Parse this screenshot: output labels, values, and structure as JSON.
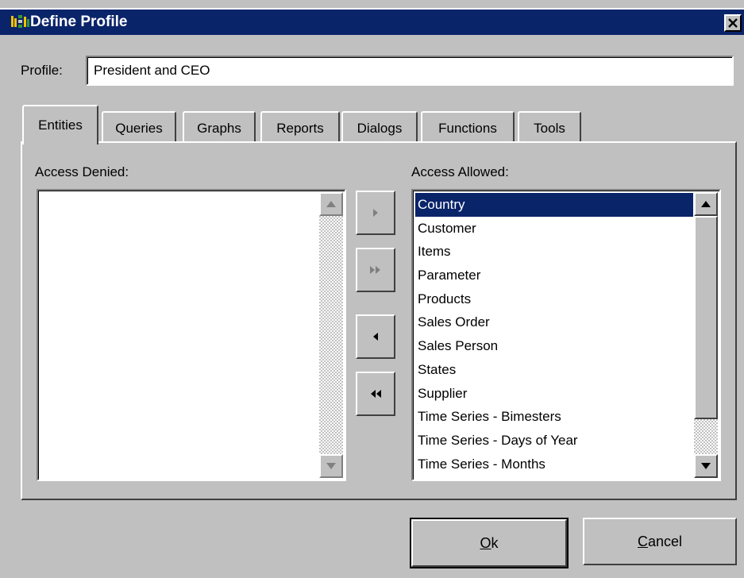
{
  "window": {
    "title": "Define Profile",
    "icon": "app-icon",
    "close_icon": "close-icon"
  },
  "profile": {
    "label": "Profile:",
    "value": "President and CEO"
  },
  "tabs": [
    {
      "label": "Entities",
      "active": true
    },
    {
      "label": "Queries"
    },
    {
      "label": "Graphs"
    },
    {
      "label": "Reports"
    },
    {
      "label": "Dialogs"
    },
    {
      "label": "Functions"
    },
    {
      "label": "Tools"
    }
  ],
  "denied": {
    "caption": "Access Denied:",
    "items": []
  },
  "allowed": {
    "caption": "Access Allowed:",
    "selected": "Country",
    "items": [
      "Country",
      "Customer",
      "Items",
      "Parameter",
      "Products",
      "Sales Order",
      "Sales Person",
      "States",
      "Supplier",
      "Time Series - Bimesters",
      "Time Series - Days of Year",
      "Time Series - Months"
    ]
  },
  "move_buttons": {
    "add_one_icon": "arrow-right-icon",
    "add_all_icon": "double-arrow-right-icon",
    "remove_one_icon": "arrow-left-icon",
    "remove_all_icon": "double-arrow-left-icon"
  },
  "buttons": {
    "ok_mnemonic": "O",
    "ok_rest": "k",
    "cancel_mnemonic": "C",
    "cancel_rest": "ancel"
  },
  "colors": {
    "titlebar": "#0a246a",
    "selection": "#0a246a",
    "face": "#c0c0c0"
  }
}
